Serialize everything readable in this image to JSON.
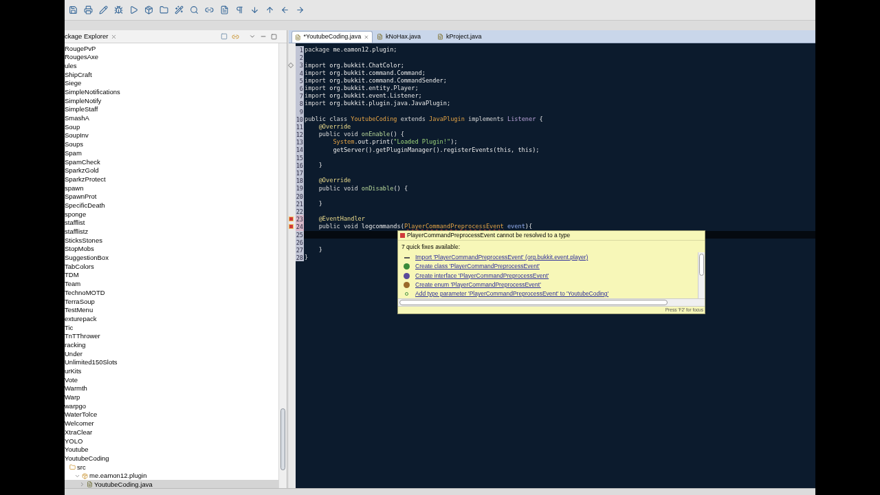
{
  "explorer": {
    "title": "ckage Explorer",
    "items": [
      {
        "label": "RougePvP"
      },
      {
        "label": "RougesAxe"
      },
      {
        "label": "ules"
      },
      {
        "label": "ShipCraft"
      },
      {
        "label": "Siege"
      },
      {
        "label": "SimpleNotifications"
      },
      {
        "label": "SimpleNotify"
      },
      {
        "label": "SimpleStaff"
      },
      {
        "label": "SmashA"
      },
      {
        "label": "Soup"
      },
      {
        "label": "SoupInv"
      },
      {
        "label": "Soups"
      },
      {
        "label": "Spam"
      },
      {
        "label": "SpamCheck"
      },
      {
        "label": "SparkzGold"
      },
      {
        "label": "SparkzProtect"
      },
      {
        "label": "spawn"
      },
      {
        "label": "SpawnProt"
      },
      {
        "label": "SpecificDeath"
      },
      {
        "label": "sponge"
      },
      {
        "label": "stafflist"
      },
      {
        "label": "stafflistz"
      },
      {
        "label": "SticksStones"
      },
      {
        "label": "StopMobs"
      },
      {
        "label": "SuggestionBox"
      },
      {
        "label": "TabColors"
      },
      {
        "label": "TDM"
      },
      {
        "label": "Team"
      },
      {
        "label": "TechnoMOTD"
      },
      {
        "label": "TerraSoup"
      },
      {
        "label": "TestMenu"
      },
      {
        "label": "exturepack"
      },
      {
        "label": "Tic"
      },
      {
        "label": "TnTThrower"
      },
      {
        "label": "racking"
      },
      {
        "label": "Under"
      },
      {
        "label": "Unlimited150Slots"
      },
      {
        "label": "urKits"
      },
      {
        "label": "Vote"
      },
      {
        "label": "Warmth"
      },
      {
        "label": "Warp"
      },
      {
        "label": "warpgo"
      },
      {
        "label": "WaterTolce"
      },
      {
        "label": "Welcomer"
      },
      {
        "label": "XtraClear"
      },
      {
        "label": "YOLO"
      },
      {
        "label": "Youtube"
      },
      {
        "label": "YoutubeCoding",
        "children": [
          {
            "label": "src",
            "kind": "source-folder",
            "children": [
              {
                "label": "me.eamon12.plugin",
                "kind": "package",
                "expanded": true,
                "selected": false,
                "children": [
                  {
                    "label": "YoutubeCoding.java",
                    "kind": "file",
                    "expanded": false,
                    "selected": true
                  }
                ]
              }
            ]
          }
        ]
      }
    ]
  },
  "editor": {
    "tabs": [
      {
        "label": "*YoutubeCoding.java",
        "selected": true
      },
      {
        "label": "kNoHax.java",
        "selected": false
      },
      {
        "label": "kProject.java",
        "selected": false
      }
    ],
    "lines": [
      {
        "number": "1",
        "kind": "plain",
        "current": false,
        "tokens": [
          {
            "kind": "keyword",
            "text": "package"
          },
          {
            "kind": "plain",
            "text": " me.eamon12.plugin;"
          }
        ]
      },
      {
        "number": "2",
        "kind": "plain",
        "current": false
      },
      {
        "number": "3",
        "kind": "warning",
        "current": false,
        "tokens": [
          {
            "kind": "keyword",
            "text": "import"
          },
          {
            "kind": "plain",
            "text": " org.bukkit.ChatColor;"
          }
        ]
      },
      {
        "number": "4",
        "kind": "plain",
        "current": false,
        "tokens": [
          {
            "kind": "keyword",
            "text": "import"
          },
          {
            "kind": "plain",
            "text": " org.bukkit.command.Command;"
          }
        ]
      },
      {
        "number": "5",
        "kind": "plain",
        "current": false,
        "tokens": [
          {
            "kind": "keyword",
            "text": "import"
          },
          {
            "kind": "plain",
            "text": " org.bukkit.command.CommandSender;"
          }
        ]
      },
      {
        "number": "6",
        "kind": "plain",
        "current": false,
        "tokens": [
          {
            "kind": "keyword",
            "text": "import"
          },
          {
            "kind": "plain",
            "text": " org.bukkit.entity.Player;"
          }
        ]
      },
      {
        "number": "7",
        "kind": "plain",
        "current": false,
        "tokens": [
          {
            "kind": "keyword",
            "text": "import"
          },
          {
            "kind": "plain",
            "text": " org.bukkit.event.Listener;"
          }
        ]
      },
      {
        "number": "8",
        "kind": "plain",
        "current": false,
        "tokens": [
          {
            "kind": "keyword",
            "text": "import"
          },
          {
            "kind": "plain",
            "text": " org.bukkit.plugin.java.JavaPlugin;"
          }
        ]
      },
      {
        "number": "9",
        "kind": "plain",
        "current": false
      },
      {
        "number": "10",
        "kind": "plain",
        "current": false,
        "tokens": [
          {
            "kind": "keyword",
            "text": "public class "
          },
          {
            "kind": "type",
            "text": "YoutubeCoding"
          },
          {
            "kind": "keyword",
            "text": " extends "
          },
          {
            "kind": "type",
            "text": "JavaPlugin"
          },
          {
            "kind": "keyword",
            "text": " implements "
          },
          {
            "kind": "interface",
            "text": "Listener"
          },
          {
            "kind": "plain",
            "text": " {"
          }
        ]
      },
      {
        "number": "11",
        "kind": "plain",
        "current": false,
        "tokens": [
          {
            "kind": "annotation",
            "text": "    @Override"
          }
        ]
      },
      {
        "number": "12",
        "kind": "plain",
        "current": false,
        "tokens": [
          {
            "kind": "keyword",
            "text": "    public void "
          },
          {
            "kind": "method",
            "text": "onEnable"
          },
          {
            "kind": "plain",
            "text": "() {"
          }
        ]
      },
      {
        "number": "13",
        "kind": "plain",
        "current": false,
        "tokens": [
          {
            "kind": "type",
            "text": "        System"
          },
          {
            "kind": "plain",
            "text": ".out.print("
          },
          {
            "kind": "string",
            "text": "\"Loaded Plugin!\""
          },
          {
            "kind": "plain",
            "text": ");"
          }
        ]
      },
      {
        "number": "14",
        "kind": "plain",
        "current": false,
        "tokens": [
          {
            "kind": "plain",
            "text": "        getServer().getPluginManager().registerEvents(this, this);"
          }
        ]
      },
      {
        "number": "15",
        "kind": "plain",
        "current": false
      },
      {
        "number": "16",
        "kind": "plain",
        "current": false,
        "tokens": [
          {
            "kind": "plain",
            "text": "    }"
          }
        ]
      },
      {
        "number": "17",
        "kind": "plain",
        "current": false
      },
      {
        "number": "18",
        "kind": "plain",
        "current": false,
        "tokens": [
          {
            "kind": "annotation",
            "text": "    @Override"
          }
        ]
      },
      {
        "number": "19",
        "kind": "plain",
        "current": false,
        "tokens": [
          {
            "kind": "keyword",
            "text": "    public void "
          },
          {
            "kind": "method",
            "text": "onDisable"
          },
          {
            "kind": "plain",
            "text": "() {"
          }
        ]
      },
      {
        "number": "20",
        "kind": "plain",
        "current": false
      },
      {
        "number": "21",
        "kind": "plain",
        "current": false,
        "tokens": [
          {
            "kind": "plain",
            "text": "    }"
          }
        ]
      },
      {
        "number": "22",
        "kind": "plain",
        "current": false
      },
      {
        "number": "23",
        "kind": "error",
        "current": false,
        "tokens": [
          {
            "kind": "annotation",
            "text": "    @EventHandler"
          }
        ]
      },
      {
        "number": "24",
        "kind": "error",
        "current": false,
        "tokens": [
          {
            "kind": "keyword",
            "text": "    public void "
          },
          {
            "kind": "plain",
            "text": "logcommands("
          },
          {
            "kind": "error",
            "text": "PlayerCommandPreprocessEvent"
          },
          {
            "kind": "param",
            "text": " event"
          },
          {
            "kind": "plain",
            "text": "){"
          }
        ]
      },
      {
        "number": "25",
        "kind": "plain",
        "current": true
      },
      {
        "number": "26",
        "kind": "plain",
        "current": false
      },
      {
        "number": "27",
        "kind": "plain",
        "current": false,
        "tokens": [
          {
            "kind": "plain",
            "text": "    }"
          }
        ]
      },
      {
        "number": "28",
        "kind": "plain",
        "current": false,
        "tokens": [
          {
            "kind": "plain",
            "text": "}"
          }
        ]
      }
    ]
  },
  "quick_fix": {
    "problem": "PlayerCommandPreprocessEvent cannot be resolved to a type",
    "count_label": "7 quick fixes available:",
    "fixes": [
      {
        "kind": "import",
        "label": "Import 'PlayerCommandPreprocessEvent' (org.bukkit.event.player)"
      },
      {
        "kind": "class",
        "label": "Create class 'PlayerCommandPreprocessEvent'"
      },
      {
        "kind": "interface",
        "label": "Create interface 'PlayerCommandPreprocessEvent'"
      },
      {
        "kind": "enum",
        "label": "Create enum 'PlayerCommandPreprocessEvent'"
      },
      {
        "kind": "type-parameter",
        "label": "Add type parameter 'PlayerCommandPreprocessEvent' to 'YoutubeCoding'"
      }
    ],
    "footer": "Press 'F2' for focus"
  }
}
